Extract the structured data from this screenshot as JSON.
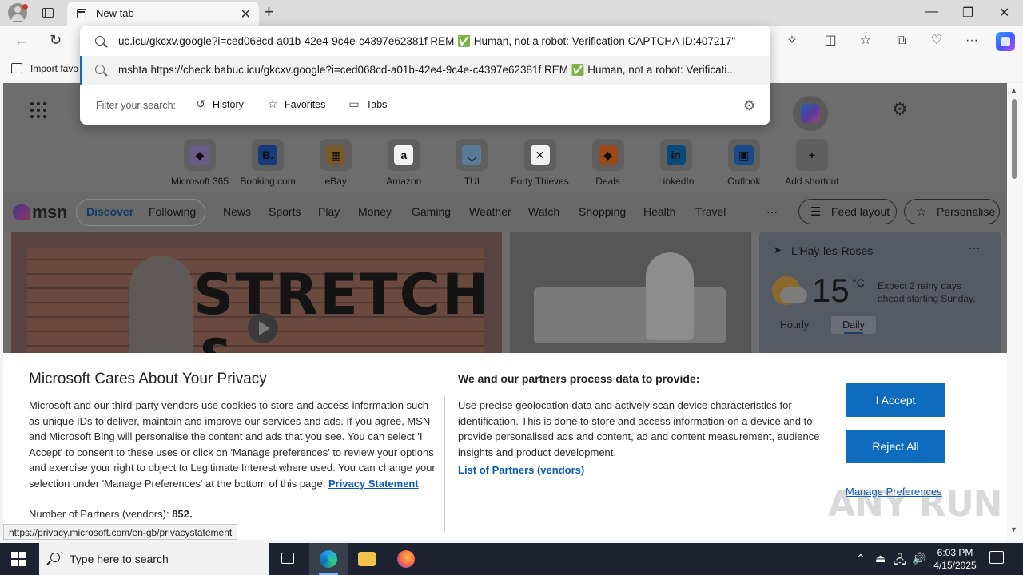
{
  "browser": {
    "tab_title": "New tab",
    "tab_close_glyph": "✕",
    "new_tab_glyph": "+",
    "window_controls": {
      "minimize": "—",
      "restore": "❐",
      "close": "✕"
    },
    "nav": {
      "back": "←",
      "reload": "↻"
    },
    "toolbar_icons": {
      "extensions": "✧",
      "split_screen": "◫",
      "favorites": "☆",
      "collections": "⧉",
      "performance": "♡",
      "more": "···"
    },
    "bookmark_label": "Import favo"
  },
  "omnibox": {
    "suggestion_1": "uc.icu/gkcxv.google?i=ced068cd-a01b-42e4-9c4e-c4397e62381f REM ✅ Human, not a robot: Verification CAPTCHA ID:407217\"",
    "suggestion_2": "mshta https://check.babuc.icu/gkcxv.google?i=ced068cd-a01b-42e4-9c4e-c4397e62381f REM ✅ Human, not a robot: Verificati...",
    "filter_label": "Filter your search:",
    "filters": [
      {
        "label": "History",
        "glyph": "↺"
      },
      {
        "label": "Favorites",
        "glyph": "☆"
      },
      {
        "label": "Tabs",
        "glyph": "▭"
      }
    ],
    "settings_glyph": "⚙"
  },
  "new_tab_page": {
    "settings_glyph": "⚙",
    "shortcuts": [
      {
        "label": "Microsoft 365",
        "glyph": "◆",
        "color": "#6a5a8a"
      },
      {
        "label": "Booking.com",
        "glyph": "B.",
        "color": "#173a7a"
      },
      {
        "label": "eBay",
        "glyph": "▦",
        "color": "#7a5a2a"
      },
      {
        "label": "Amazon",
        "glyph": "a",
        "color": "#f1f1f1"
      },
      {
        "label": "TUI",
        "glyph": "◡",
        "color": "#5a7a9a"
      },
      {
        "label": "Forty Thieves",
        "glyph": "✕",
        "color": "#f1f1f1"
      },
      {
        "label": "Deals",
        "glyph": "◆",
        "color": "#9a4a1a"
      },
      {
        "label": "LinkedIn",
        "glyph": "in",
        "color": "#0a4a7a"
      },
      {
        "label": "Outlook",
        "glyph": "▣",
        "color": "#1a4a8a"
      },
      {
        "label": "Add shortcut",
        "glyph": "+",
        "color": "#5f5f5f"
      }
    ]
  },
  "msn": {
    "logo": "msn",
    "tabs": [
      "Discover",
      "Following"
    ],
    "nav": [
      "News",
      "Sports",
      "Play",
      "Money",
      "Gaming",
      "Weather",
      "Watch",
      "Shopping",
      "Health",
      "Travel"
    ],
    "overflow": "···",
    "feed_layout": "Feed layout",
    "personalise": "Personalise",
    "hero_text": "STRETCH &",
    "weather": {
      "location": "L'Haÿ-les-Roses",
      "temp": "15",
      "unit": "°C",
      "forecast": "Expect 2 rainy days ahead starting Sunday.",
      "hourly": "Hourly",
      "daily": "Daily"
    }
  },
  "privacy": {
    "title": "Microsoft Cares About Your Privacy",
    "body": "Microsoft and our third-party vendors use cookies to store and access information such as unique IDs to deliver, maintain and improve our services and ads. If you agree, MSN and Microsoft Bing will personalise the content and ads that you see. You can select 'I Accept' to consent to these uses or click on 'Manage preferences' to review your options and exercise your right to object to Legitimate Interest where used.  You can change your selection under 'Manage Preferences' at the bottom of this page. ",
    "privacy_link": "Privacy Statement",
    "partners_label": "Number of Partners (vendors): ",
    "partners_count": "852.",
    "data_heading": "We and our partners process data to provide:",
    "data_body": "Use precise geolocation data and actively scan device characteristics for identification. This is done to store and access information on a device and to provide personalised ads and content, ad and content measurement, audience insights and product development.",
    "vendors_link": "List of Partners (vendors)",
    "accept": "I Accept",
    "reject": "Reject All",
    "manage": "Manage Preferences"
  },
  "status_url": "https://privacy.microsoft.com/en-gb/privacystatement",
  "watermark": "ANY RUN",
  "taskbar": {
    "search_placeholder": "Type here to search",
    "time": "6:03 PM",
    "date": "4/15/2025",
    "tray": {
      "chevron": "⌃",
      "network": "🖧",
      "volume": "🔊"
    }
  },
  "colors": {
    "accent": "#0f6cbd",
    "link": "#0b5bb5",
    "taskbar": "#1c2230"
  }
}
